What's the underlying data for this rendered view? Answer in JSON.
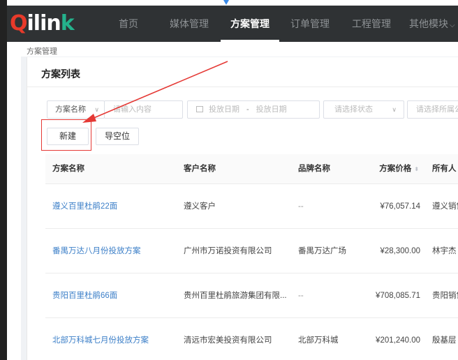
{
  "nav": {
    "logo_q": "Q",
    "logo_i": "ilin",
    "logo_k": "k",
    "items": [
      {
        "label": "首页"
      },
      {
        "label": "媒体管理"
      },
      {
        "label": "方案管理"
      },
      {
        "label": "订单管理"
      },
      {
        "label": "工程管理"
      },
      {
        "label": "其他模块"
      }
    ],
    "more_chevron": "⌵"
  },
  "breadcrumb": "方案管理",
  "card": {
    "title": "方案列表"
  },
  "filters": {
    "name_select": "方案名称",
    "keyword_placeholder": "请输入内容",
    "date_start": "投放日期",
    "date_sep": "-",
    "date_end": "投放日期",
    "status_placeholder": "请选择状态",
    "company_placeholder": "请选择所属公司"
  },
  "actions": {
    "new_label": "新建",
    "export_label": "导空位"
  },
  "table": {
    "headers": [
      "方案名称",
      "客户名称",
      "品牌名称",
      "方案价格",
      "所有人"
    ],
    "rows": [
      {
        "name": "遵义百里杜鹃22面",
        "client": "遵义客户",
        "brand": "--",
        "price": "¥76,057.14",
        "owner": "遵义销售"
      },
      {
        "name": "番禺万达八月份投放方案",
        "client": "广州市万诺投资有限公司",
        "brand": "番禺万达广场",
        "price": "¥28,300.00",
        "owner": "林宇杰"
      },
      {
        "name": "贵阳百里杜鹃66面",
        "client": "贵州百里杜鹃旅游集团有限...",
        "brand": "--",
        "price": "¥708,085.71",
        "owner": "贵阳销售"
      },
      {
        "name": "北部万科城七月份投放方案",
        "client": "清远市宏美投资有限公司",
        "brand": "北部万科城",
        "price": "¥201,240.00",
        "owner": "殷基层"
      }
    ]
  },
  "colors": {
    "nav_bg": "#2f3234",
    "link": "#3c7fc8",
    "annotation_red": "#e53935",
    "logo_red": "#e83a2a",
    "logo_green": "#24b28c"
  }
}
